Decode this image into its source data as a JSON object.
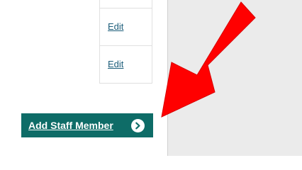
{
  "staff_table": {
    "rows": [
      {
        "action_label": "Edit"
      },
      {
        "action_label": "Edit"
      }
    ]
  },
  "add_button": {
    "label": "Add Staff Member",
    "icon": "chevron-right-circle-icon"
  },
  "annotation": {
    "icon": "red-arrow-pointer",
    "color": "#ff0000"
  },
  "colors": {
    "button_background": "#0e6c67",
    "link": "#1c5d7a",
    "sidebar_background": "#ebebeb"
  }
}
